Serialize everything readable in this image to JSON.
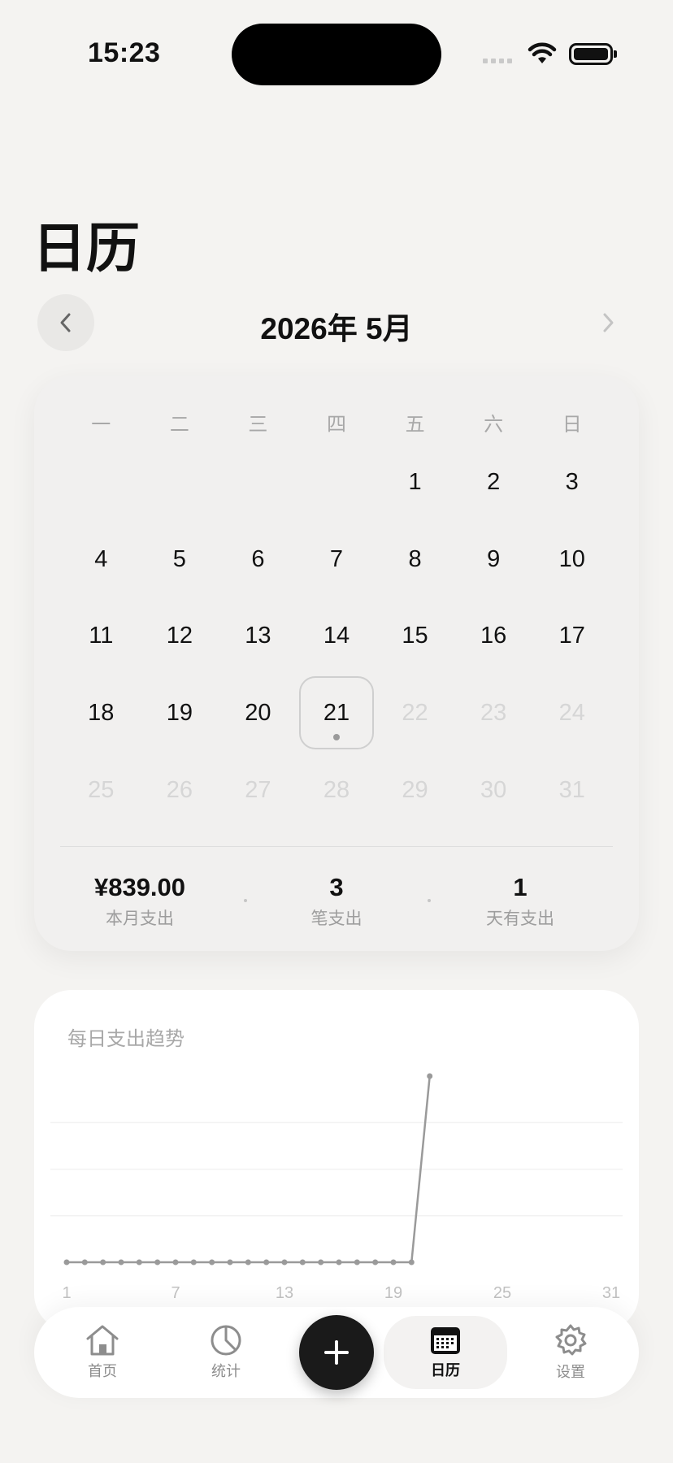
{
  "status_bar": {
    "time": "15:23"
  },
  "page": {
    "title": "日历"
  },
  "month_nav": {
    "label": "2026年 5月",
    "prev_icon": "chevron-left-icon",
    "next_icon": "chevron-right-icon"
  },
  "calendar": {
    "weekdays": [
      "一",
      "二",
      "三",
      "四",
      "五",
      "六",
      "日"
    ],
    "leading_blanks": 4,
    "days_in_month": 31,
    "today": 21,
    "days_with_expense": [
      21
    ],
    "summary": [
      {
        "value": "¥839.00",
        "label": "本月支出"
      },
      {
        "value": "3",
        "label": "笔支出"
      },
      {
        "value": "1",
        "label": "天有支出"
      }
    ]
  },
  "chart_data": {
    "type": "line",
    "title": "每日支出趋势",
    "x_tick_labels": [
      "1",
      "7",
      "13",
      "19",
      "25",
      "31"
    ],
    "x": [
      1,
      2,
      3,
      4,
      5,
      6,
      7,
      8,
      9,
      10,
      11,
      12,
      13,
      14,
      15,
      16,
      17,
      18,
      19,
      20,
      21
    ],
    "series": [
      {
        "values": [
          0,
          0,
          0,
          0,
          0,
          0,
          0,
          0,
          0,
          0,
          0,
          0,
          0,
          0,
          0,
          0,
          0,
          0,
          0,
          0,
          839
        ]
      }
    ],
    "xlim": [
      1,
      31
    ],
    "ylim": [
      0,
      839
    ],
    "grid": true,
    "color": "#9a9a9a"
  },
  "tabbar": {
    "tabs": [
      {
        "label": "首页",
        "icon": "home-icon"
      },
      {
        "label": "统计",
        "icon": "pie-chart-icon"
      },
      {
        "label": "日历",
        "icon": "calendar-icon"
      },
      {
        "label": "设置",
        "icon": "gear-icon"
      }
    ],
    "add_icon": "plus-icon"
  }
}
